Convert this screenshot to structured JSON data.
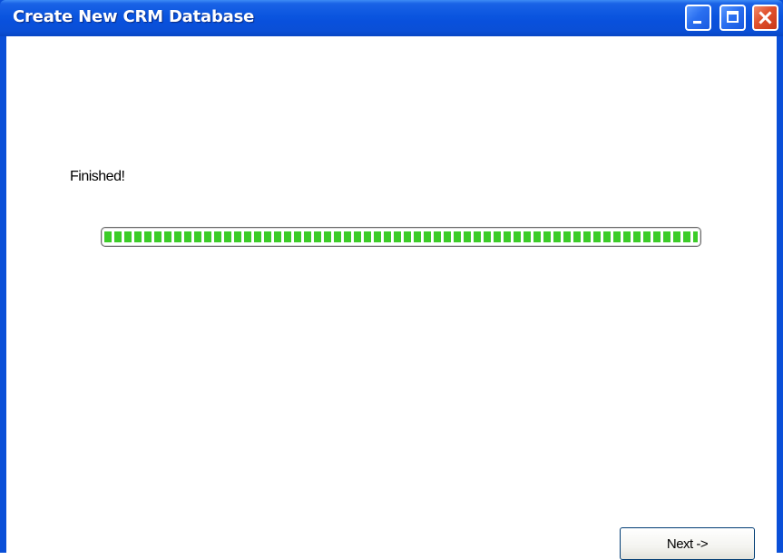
{
  "window": {
    "title": "Create New CRM Database",
    "controls": [
      "minimize-icon",
      "maximize-icon",
      "close-icon"
    ]
  },
  "main": {
    "status_text": "Finished!",
    "progress": {
      "percent": 100,
      "color": "#3ccc28"
    },
    "next_label": "Next ->"
  },
  "colors": {
    "titlebar": "#0a55df",
    "close_button": "#e0502c"
  }
}
